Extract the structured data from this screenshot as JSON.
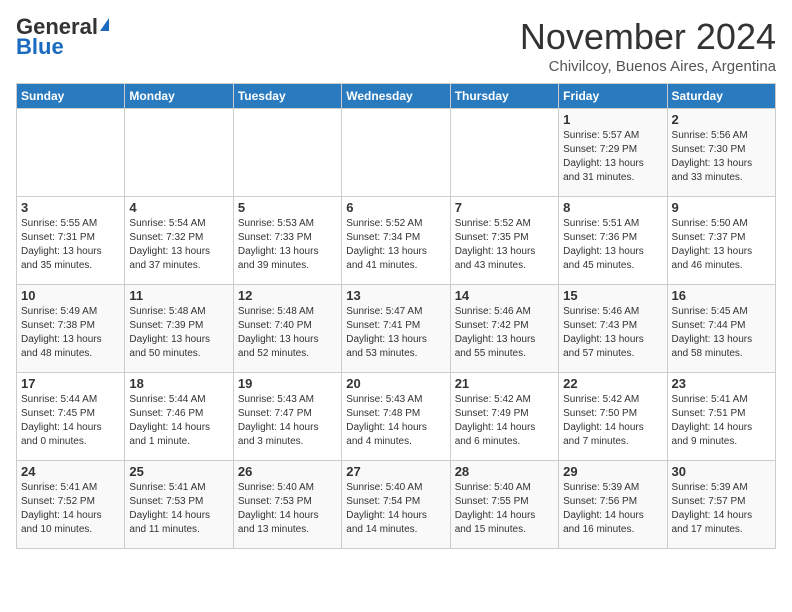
{
  "header": {
    "logo_general": "General",
    "logo_blue": "Blue",
    "month": "November 2024",
    "location": "Chivilcoy, Buenos Aires, Argentina"
  },
  "weekdays": [
    "Sunday",
    "Monday",
    "Tuesday",
    "Wednesday",
    "Thursday",
    "Friday",
    "Saturday"
  ],
  "weeks": [
    [
      {
        "day": "",
        "info": ""
      },
      {
        "day": "",
        "info": ""
      },
      {
        "day": "",
        "info": ""
      },
      {
        "day": "",
        "info": ""
      },
      {
        "day": "",
        "info": ""
      },
      {
        "day": "1",
        "info": "Sunrise: 5:57 AM\nSunset: 7:29 PM\nDaylight: 13 hours\nand 31 minutes."
      },
      {
        "day": "2",
        "info": "Sunrise: 5:56 AM\nSunset: 7:30 PM\nDaylight: 13 hours\nand 33 minutes."
      }
    ],
    [
      {
        "day": "3",
        "info": "Sunrise: 5:55 AM\nSunset: 7:31 PM\nDaylight: 13 hours\nand 35 minutes."
      },
      {
        "day": "4",
        "info": "Sunrise: 5:54 AM\nSunset: 7:32 PM\nDaylight: 13 hours\nand 37 minutes."
      },
      {
        "day": "5",
        "info": "Sunrise: 5:53 AM\nSunset: 7:33 PM\nDaylight: 13 hours\nand 39 minutes."
      },
      {
        "day": "6",
        "info": "Sunrise: 5:52 AM\nSunset: 7:34 PM\nDaylight: 13 hours\nand 41 minutes."
      },
      {
        "day": "7",
        "info": "Sunrise: 5:52 AM\nSunset: 7:35 PM\nDaylight: 13 hours\nand 43 minutes."
      },
      {
        "day": "8",
        "info": "Sunrise: 5:51 AM\nSunset: 7:36 PM\nDaylight: 13 hours\nand 45 minutes."
      },
      {
        "day": "9",
        "info": "Sunrise: 5:50 AM\nSunset: 7:37 PM\nDaylight: 13 hours\nand 46 minutes."
      }
    ],
    [
      {
        "day": "10",
        "info": "Sunrise: 5:49 AM\nSunset: 7:38 PM\nDaylight: 13 hours\nand 48 minutes."
      },
      {
        "day": "11",
        "info": "Sunrise: 5:48 AM\nSunset: 7:39 PM\nDaylight: 13 hours\nand 50 minutes."
      },
      {
        "day": "12",
        "info": "Sunrise: 5:48 AM\nSunset: 7:40 PM\nDaylight: 13 hours\nand 52 minutes."
      },
      {
        "day": "13",
        "info": "Sunrise: 5:47 AM\nSunset: 7:41 PM\nDaylight: 13 hours\nand 53 minutes."
      },
      {
        "day": "14",
        "info": "Sunrise: 5:46 AM\nSunset: 7:42 PM\nDaylight: 13 hours\nand 55 minutes."
      },
      {
        "day": "15",
        "info": "Sunrise: 5:46 AM\nSunset: 7:43 PM\nDaylight: 13 hours\nand 57 minutes."
      },
      {
        "day": "16",
        "info": "Sunrise: 5:45 AM\nSunset: 7:44 PM\nDaylight: 13 hours\nand 58 minutes."
      }
    ],
    [
      {
        "day": "17",
        "info": "Sunrise: 5:44 AM\nSunset: 7:45 PM\nDaylight: 14 hours\nand 0 minutes."
      },
      {
        "day": "18",
        "info": "Sunrise: 5:44 AM\nSunset: 7:46 PM\nDaylight: 14 hours\nand 1 minute."
      },
      {
        "day": "19",
        "info": "Sunrise: 5:43 AM\nSunset: 7:47 PM\nDaylight: 14 hours\nand 3 minutes."
      },
      {
        "day": "20",
        "info": "Sunrise: 5:43 AM\nSunset: 7:48 PM\nDaylight: 14 hours\nand 4 minutes."
      },
      {
        "day": "21",
        "info": "Sunrise: 5:42 AM\nSunset: 7:49 PM\nDaylight: 14 hours\nand 6 minutes."
      },
      {
        "day": "22",
        "info": "Sunrise: 5:42 AM\nSunset: 7:50 PM\nDaylight: 14 hours\nand 7 minutes."
      },
      {
        "day": "23",
        "info": "Sunrise: 5:41 AM\nSunset: 7:51 PM\nDaylight: 14 hours\nand 9 minutes."
      }
    ],
    [
      {
        "day": "24",
        "info": "Sunrise: 5:41 AM\nSunset: 7:52 PM\nDaylight: 14 hours\nand 10 minutes."
      },
      {
        "day": "25",
        "info": "Sunrise: 5:41 AM\nSunset: 7:53 PM\nDaylight: 14 hours\nand 11 minutes."
      },
      {
        "day": "26",
        "info": "Sunrise: 5:40 AM\nSunset: 7:53 PM\nDaylight: 14 hours\nand 13 minutes."
      },
      {
        "day": "27",
        "info": "Sunrise: 5:40 AM\nSunset: 7:54 PM\nDaylight: 14 hours\nand 14 minutes."
      },
      {
        "day": "28",
        "info": "Sunrise: 5:40 AM\nSunset: 7:55 PM\nDaylight: 14 hours\nand 15 minutes."
      },
      {
        "day": "29",
        "info": "Sunrise: 5:39 AM\nSunset: 7:56 PM\nDaylight: 14 hours\nand 16 minutes."
      },
      {
        "day": "30",
        "info": "Sunrise: 5:39 AM\nSunset: 7:57 PM\nDaylight: 14 hours\nand 17 minutes."
      }
    ]
  ]
}
